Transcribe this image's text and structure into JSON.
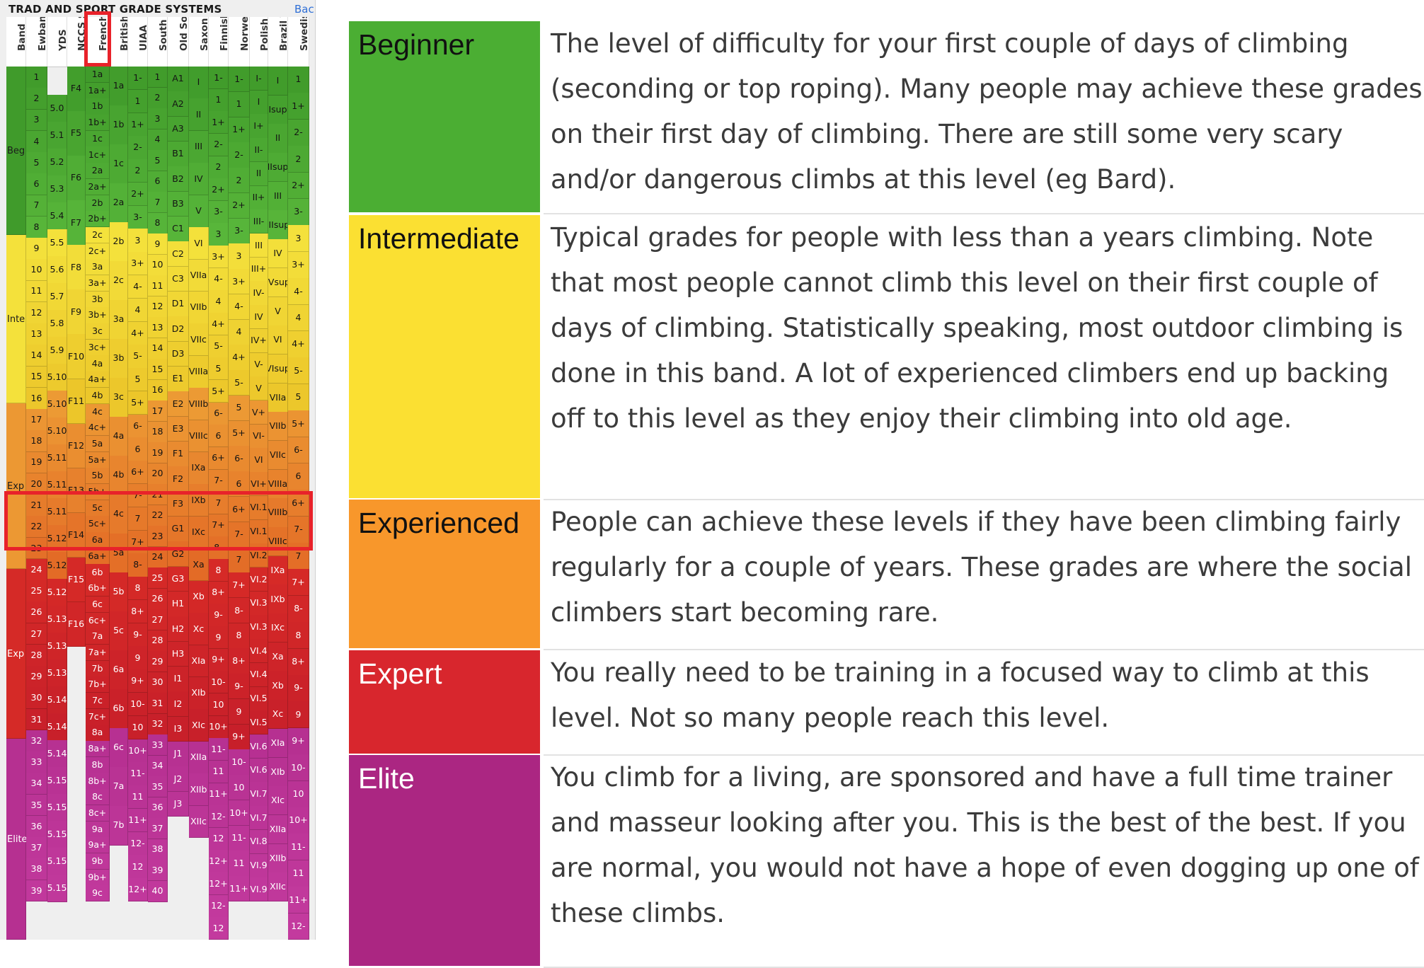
{
  "page": {
    "title": "TRAD AND SPORT GRADE SYSTEMS",
    "back_link": "Bac"
  },
  "columns": [
    "Band",
    "Ewbank",
    "YDS",
    "NCCS Scale",
    "French",
    "British Tech.",
    "UIAA",
    "South African",
    "Old South African",
    "Saxon",
    "Finnish",
    "Norwegian",
    "Polish",
    "Brazil Technical",
    "Swedish"
  ],
  "band_abbrev": [
    "Beg",
    "Inte",
    "Exp",
    "Exp",
    "Elite"
  ],
  "band_colors": {
    "beginner": "#4aa832",
    "intermediate": "#f0dc2c",
    "experienced": "#e8882e",
    "expert": "#d42427",
    "elite": "#b6298f"
  },
  "grades": {
    "ewbank": [
      "1",
      "2",
      "3",
      "4",
      "5",
      "6",
      "7",
      "8",
      "9",
      "10",
      "11",
      "12",
      "13",
      "14",
      "15",
      "16",
      "17",
      "18",
      "19",
      "20",
      "21",
      "22",
      "23",
      "24",
      "25",
      "26",
      "27",
      "28",
      "29",
      "30",
      "31",
      "32",
      "33",
      "34",
      "35",
      "36",
      "37",
      "38",
      "39"
    ],
    "yds": [
      "5.0",
      "5.1",
      "5.2",
      "5.3",
      "5.4",
      "5.5",
      "5.6",
      "5.7",
      "5.8",
      "5.9",
      "5.10",
      "5.10",
      "5.10",
      "5.11",
      "5.11",
      "5.11",
      "5.12",
      "5.12",
      "5.12",
      "5.13",
      "5.13",
      "5.13",
      "5.14",
      "5.14",
      "5.14",
      "5.15",
      "5.15",
      "5.15",
      "5.15",
      "5.15"
    ],
    "nccs": [
      "F4",
      "F5",
      "F6",
      "F7",
      "F8",
      "F9",
      "F10",
      "F11",
      "F12",
      "F13",
      "F14",
      "F15",
      "F16"
    ],
    "french": [
      "1a",
      "1a+",
      "1b",
      "1b+",
      "1c",
      "1c+",
      "2a",
      "2a+",
      "2b",
      "2b+",
      "2c",
      "2c+",
      "3a",
      "3a+",
      "3b",
      "3b+",
      "3c",
      "3c+",
      "4a",
      "4a+",
      "4b",
      "4c",
      "4c+",
      "5a",
      "5a+",
      "5b",
      "5b+",
      "5c",
      "5c+",
      "6a",
      "6a+",
      "6b",
      "6b+",
      "6c",
      "6c+",
      "7a",
      "7a+",
      "7b",
      "7b+",
      "7c",
      "7c+",
      "8a",
      "8a+",
      "8b",
      "8b+",
      "8c",
      "8c+",
      "9a",
      "9a+",
      "9b",
      "9b+",
      "9c"
    ],
    "british": [
      "1a",
      "1b",
      "1c",
      "2a",
      "2b",
      "2c",
      "3a",
      "3b",
      "3c",
      "4a",
      "4b",
      "4c",
      "5a",
      "5b",
      "5c",
      "6a",
      "6b",
      "6c",
      "7a",
      "7b"
    ],
    "uiaa": [
      "1-",
      "1",
      "1+",
      "2-",
      "2",
      "2+",
      "3-",
      "3",
      "3+",
      "4-",
      "4",
      "4+",
      "5-",
      "5",
      "5+",
      "6-",
      "6",
      "6+",
      "7-",
      "7",
      "7+",
      "8-",
      "8",
      "8+",
      "9-",
      "9",
      "9+",
      "10-",
      "10",
      "10+",
      "11-",
      "11",
      "11+",
      "12-",
      "12",
      "12+"
    ],
    "south_african": [
      "1",
      "2",
      "3",
      "4",
      "5",
      "6",
      "7",
      "8",
      "9",
      "10",
      "11",
      "12",
      "13",
      "14",
      "15",
      "16",
      "17",
      "18",
      "19",
      "20",
      "21",
      "22",
      "23",
      "24",
      "25",
      "26",
      "27",
      "28",
      "29",
      "30",
      "31",
      "32",
      "33",
      "34",
      "35",
      "36",
      "37",
      "38",
      "39",
      "40"
    ],
    "old_south_african": [
      "A1",
      "A2",
      "A3",
      "B1",
      "B2",
      "B3",
      "C1",
      "C2",
      "C3",
      "D1",
      "D2",
      "D3",
      "E1",
      "E2",
      "E3",
      "F1",
      "F2",
      "F3",
      "G1",
      "G2",
      "G3",
      "H1",
      "H2",
      "H3",
      "I1",
      "I2",
      "I3",
      "J1",
      "J2",
      "J3"
    ],
    "saxon": [
      "I",
      "II",
      "III",
      "IV",
      "V",
      "VI",
      "VIIa",
      "VIIb",
      "VIIc",
      "VIIIa",
      "VIIIb",
      "VIIIc",
      "IXa",
      "IXb",
      "IXc",
      "Xa",
      "Xb",
      "Xc",
      "XIa",
      "XIb",
      "XIc",
      "XIIa",
      "XIIb",
      "XIIc"
    ],
    "finnish": [
      "1-",
      "1",
      "1+",
      "2-",
      "2",
      "2+",
      "3-",
      "3",
      "3+",
      "4-",
      "4",
      "4+",
      "5-",
      "5",
      "5+",
      "6-",
      "6",
      "6+",
      "7-",
      "7",
      "7+",
      "8-",
      "8",
      "8+",
      "9-",
      "9",
      "9+",
      "10-",
      "10",
      "10+",
      "11-",
      "11",
      "11+",
      "12-",
      "12",
      "12+",
      "12+",
      "12-",
      "12"
    ],
    "norwegian": [
      "1-",
      "1",
      "1+",
      "2-",
      "2",
      "2+",
      "3-",
      "3",
      "3+",
      "4-",
      "4",
      "4+",
      "5-",
      "5",
      "5+",
      "6-",
      "6",
      "6+",
      "7-",
      "7",
      "7+",
      "8-",
      "8",
      "8+",
      "9-",
      "9",
      "9+",
      "10-",
      "10",
      "10+",
      "11-",
      "11",
      "11+"
    ],
    "polish": [
      "I-",
      "I",
      "I+",
      "II-",
      "II",
      "II+",
      "III-",
      "III",
      "III+",
      "IV-",
      "IV",
      "IV+",
      "V-",
      "V",
      "V+",
      "VI-",
      "VI",
      "VI+",
      "VI.1",
      "VI.1",
      "VI.2",
      "VI.2",
      "VI.3",
      "VI.3",
      "VI.4",
      "VI.4",
      "VI.5",
      "VI.5",
      "VI.6",
      "VI.6",
      "VI.7",
      "VI.7",
      "VI.8",
      "VI.9",
      "VI.9"
    ],
    "brazil": [
      "I",
      "Isup",
      "II",
      "IIsup",
      "III",
      "IIIsup",
      "IV",
      "IVsup",
      "V",
      "VI",
      "VIsup",
      "VIIa",
      "VIIb",
      "VIIc",
      "VIIIa",
      "VIIIb",
      "VIIIc",
      "IXa",
      "IXb",
      "IXc",
      "Xa",
      "Xb",
      "Xc",
      "XIa",
      "XIb",
      "XIc",
      "XIIa",
      "XIIb",
      "XIIc"
    ],
    "swedish": [
      "1",
      "1+",
      "2-",
      "2",
      "2+",
      "3-",
      "3",
      "3+",
      "4-",
      "4",
      "4+",
      "5-",
      "5",
      "5+",
      "6-",
      "6",
      "6+",
      "7-",
      "7",
      "7+",
      "8-",
      "8",
      "8+",
      "9-",
      "9",
      "9+",
      "10-",
      "10",
      "10+",
      "11-",
      "11",
      "11+",
      "12-"
    ]
  },
  "legend": [
    {
      "name": "Beginner",
      "color": "#4bae33",
      "text_color": "#111111",
      "description": "The level of difficulty for your first couple of days of climbing (seconding or top roping). Many people may achieve these grades on their first day of climbing. There are still some very scary and/or dangerous climbs at this level (eg Bard)."
    },
    {
      "name": "Intermediate",
      "color": "#fbe032",
      "text_color": "#111111",
      "description": "Typical grades for people with less than a years climbing. Note that most people cannot climb this level on their first couple of days of climbing. Statistically speaking, most outdoor climbing is done in this band. A lot of experienced climbers end up backing off to this level as they enjoy their climbing into old age."
    },
    {
      "name": "Experienced",
      "color": "#f8972b",
      "text_color": "#111111",
      "description": "People can achieve these levels if they have been climbing fairly regularly for a couple of years. These grades are where the social climbers start becoming rare."
    },
    {
      "name": "Expert",
      "color": "#d8262d",
      "text_color": "#ffffff",
      "description": "You really need to be training in a focused way to climb at this level. Not so many people reach this level."
    },
    {
      "name": "Elite",
      "color": "#ab2682",
      "text_color": "#ffffff",
      "description": "You climb for a living, are sponsored and have a full time trainer and masseur looking after you. This is the best of the best. If you are normal, you would not have a hope of even dogging up one of these climbs."
    }
  ]
}
